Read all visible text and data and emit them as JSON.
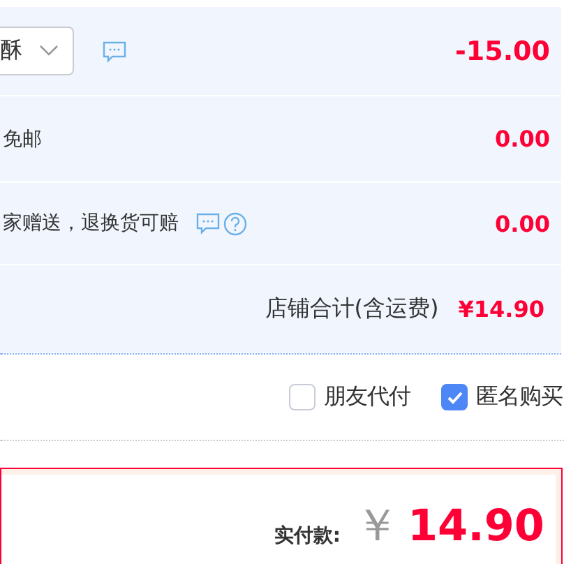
{
  "rows": [
    {
      "kind": "select",
      "select_value": "酥",
      "amount": "-15.00"
    },
    {
      "kind": "text",
      "label": "免邮",
      "amount": "0.00"
    },
    {
      "kind": "note",
      "label": "家赠送，退换货可赔",
      "amount": "0.00"
    }
  ],
  "shop_total": {
    "label": "店铺合计(含运费)",
    "amount": "¥14.90"
  },
  "options": [
    {
      "label": "朋友代付",
      "checked": false
    },
    {
      "label": "匿名购买",
      "checked": true
    }
  ],
  "payment": {
    "label": "实付款:",
    "currency": "￥",
    "amount": "14.90"
  }
}
